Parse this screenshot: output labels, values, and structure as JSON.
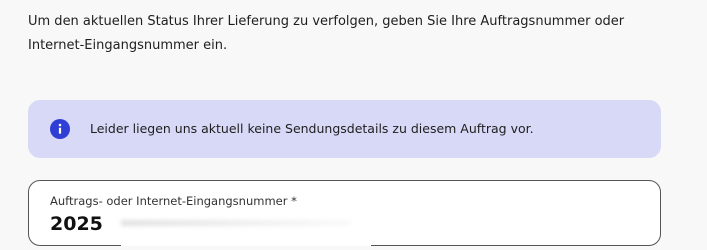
{
  "intro": {
    "text": "Um den aktuellen Status Ihrer Lieferung zu verfolgen, geben Sie Ihre Auftragsnummer oder Internet-Eingangsnummer ein."
  },
  "info_banner": {
    "icon": "info-icon",
    "message": "Leider liegen uns aktuell keine Sendungsdetails zu diesem Auftrag vor.",
    "background_color": "#d7d9f7",
    "icon_color": "#2f3fd6"
  },
  "order_input": {
    "label": "Auftrags- oder Internet-Eingangsnummer *",
    "value": "2025"
  }
}
